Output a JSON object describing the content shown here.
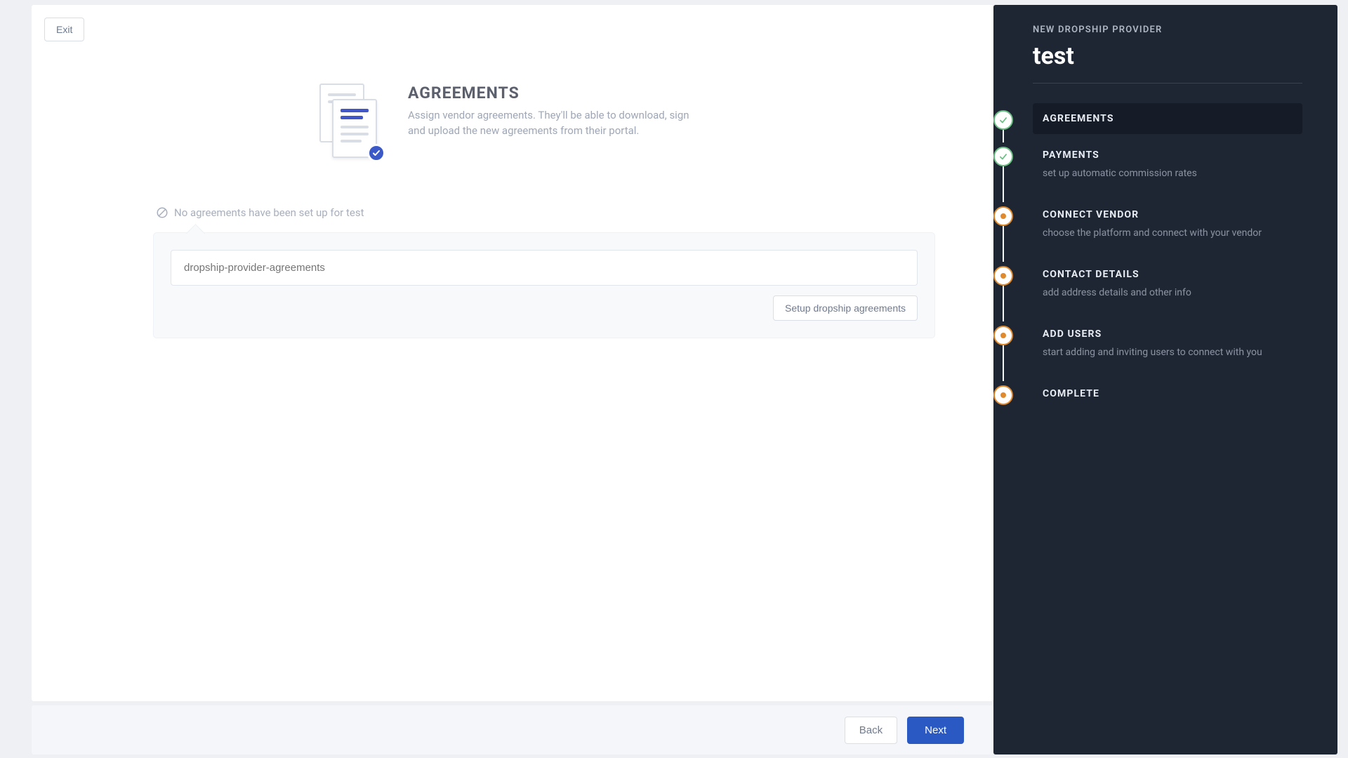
{
  "exit_label": "Exit",
  "header": {
    "title": "AGREEMENTS",
    "description": "Assign vendor agreements. They'll be able to download, sign and upload the new agreements from their portal."
  },
  "empty_state": "No agreements have been set up for test",
  "input": {
    "placeholder": "dropship-provider-agreements",
    "action_label": "Setup dropship agreements"
  },
  "footer": {
    "back_label": "Back",
    "next_label": "Next"
  },
  "sidebar": {
    "eyebrow": "NEW DROPSHIP PROVIDER",
    "title": "test",
    "steps": [
      {
        "label": "AGREEMENTS",
        "desc": "",
        "status": "complete",
        "active": true
      },
      {
        "label": "PAYMENTS",
        "desc": "set up automatic commission rates",
        "status": "complete",
        "active": false
      },
      {
        "label": "CONNECT VENDOR",
        "desc": "choose the platform and connect with your vendor",
        "status": "pending",
        "active": false
      },
      {
        "label": "CONTACT DETAILS",
        "desc": "add address details and other info",
        "status": "pending",
        "active": false
      },
      {
        "label": "ADD USERS",
        "desc": "start adding and inviting users to connect with you",
        "status": "pending",
        "active": false
      },
      {
        "label": "COMPLETE",
        "desc": "",
        "status": "pending",
        "active": false
      }
    ]
  }
}
